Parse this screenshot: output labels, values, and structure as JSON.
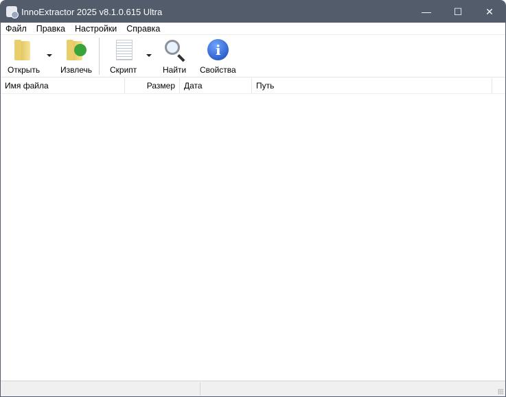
{
  "window": {
    "title": "InnoExtractor 2025 v8.1.0.615 Ultra",
    "minimize": "—",
    "maximize": "☐",
    "close": "✕"
  },
  "menu": [
    "Файл",
    "Правка",
    "Настройки",
    "Справка"
  ],
  "toolbar": {
    "open": "Открыть",
    "extract": "Извлечь",
    "script": "Скрипт",
    "find": "Найти",
    "properties": "Свойства",
    "info_glyph": "i"
  },
  "columns": [
    "Имя файла",
    "Размер",
    "Дата",
    "Путь"
  ]
}
